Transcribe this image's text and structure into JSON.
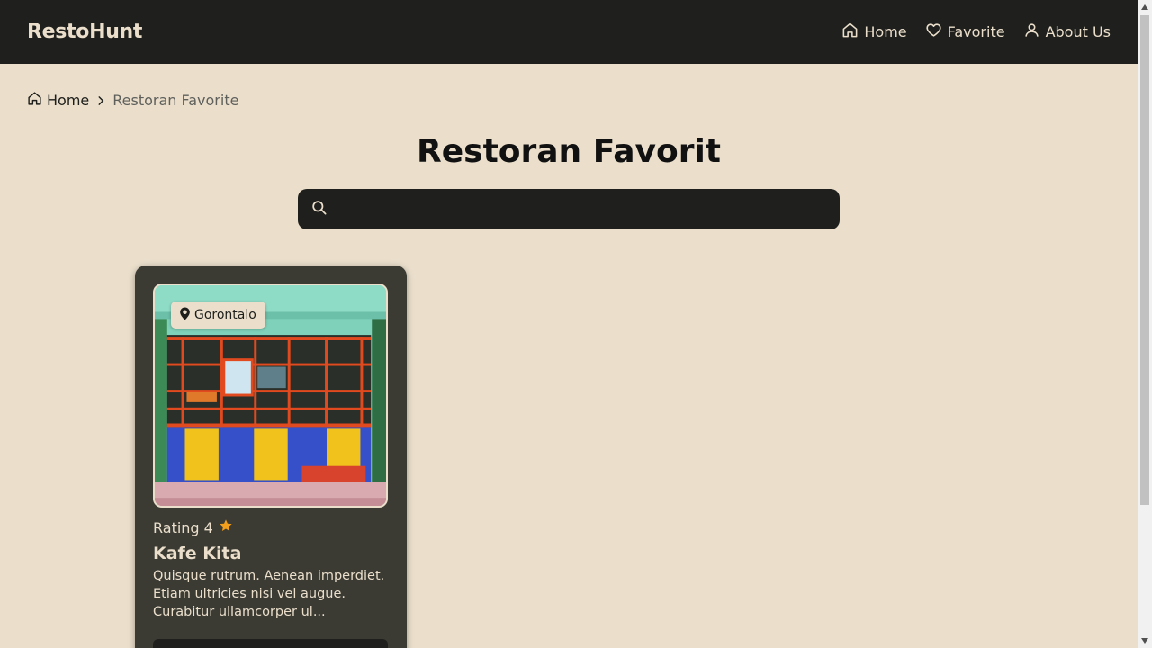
{
  "navbar": {
    "brand": "RestoHunt",
    "links": [
      {
        "label": "Home",
        "icon": "home-icon"
      },
      {
        "label": "Favorite",
        "icon": "heart-icon"
      },
      {
        "label": "About Us",
        "icon": "user-icon"
      }
    ]
  },
  "breadcrumb": {
    "home": "Home",
    "current": "Restoran Favorite"
  },
  "page": {
    "title": "Restoran Favorit"
  },
  "search": {
    "value": "",
    "icon": "search-icon"
  },
  "cards": [
    {
      "location": "Gorontalo",
      "rating_label": "Rating 4",
      "rating_value": 4,
      "name": "Kafe Kita",
      "description": "Quisque rutrum. Aenean imperdiet. Etiam ultricies nisi vel augue. Curabitur ullamcorper ul..."
    }
  ],
  "colors": {
    "background": "#ebdfcc",
    "navbar": "#1f201d",
    "card": "#3b3b34",
    "accent_star": "#f4a01c",
    "text_light": "#ebdfcc"
  }
}
